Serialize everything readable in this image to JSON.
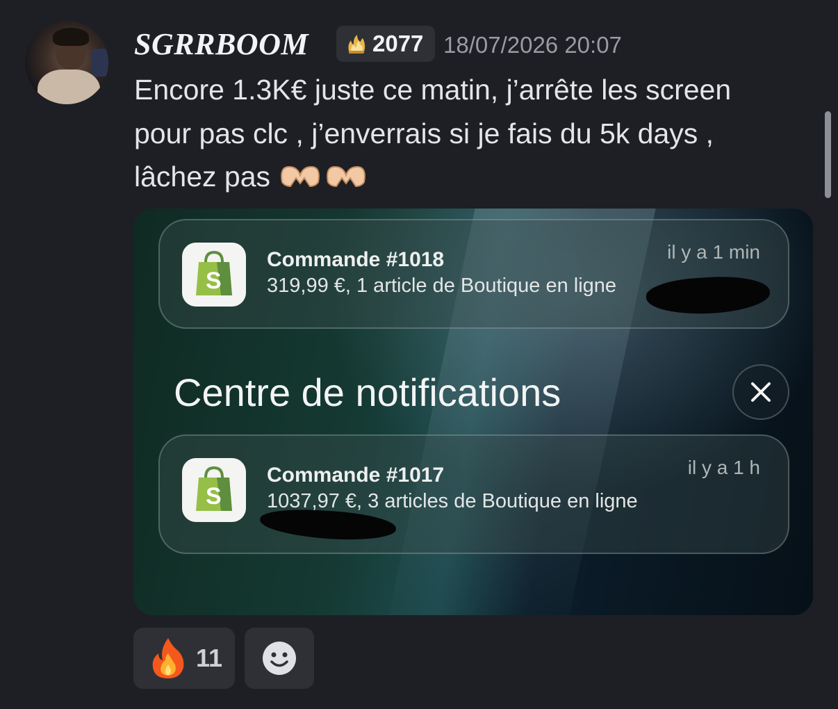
{
  "message": {
    "author": "SGRRBOOM",
    "badge": {
      "icon": "flame-crown-icon",
      "count": "2077"
    },
    "timestamp": "18/07/2026 20:07",
    "lines": [
      "Encore 1.3K€ juste ce matin, j’arrête les screen",
      "pour pas clc , j’enverrais si je fais du 5k days ,",
      "lâchez pas"
    ],
    "emoji": "heart-hands-icon"
  },
  "attachment": {
    "notifications": [
      {
        "app_icon": "shopify-bag-icon",
        "title": "Commande #1018",
        "body": "319,99 €, 1 article de Boutique en ligne",
        "time": "il y a 1 min"
      },
      {
        "app_icon": "shopify-bag-icon",
        "title": "Commande #1017",
        "body": "1037,97 €, 3 articles de Boutique en ligne",
        "time": "il y a 1 h"
      }
    ],
    "center_title": "Centre de notifications"
  },
  "reactions": [
    {
      "icon": "fire-icon",
      "count": "11"
    }
  ],
  "colors": {
    "background": "#1e1f24",
    "chip": "#2e3036",
    "shopify_green": "#95bf47"
  }
}
